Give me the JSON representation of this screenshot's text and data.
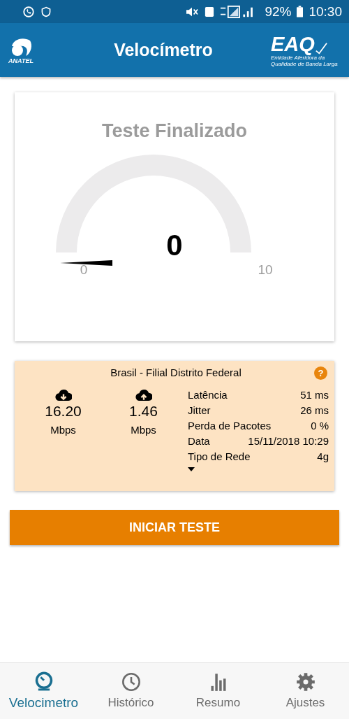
{
  "status_bar": {
    "battery": "92%",
    "time": "10:30"
  },
  "header": {
    "title": "Velocímetro",
    "left_logo": "ANATEL",
    "right_logo": "EAQ",
    "right_logo_caption": "Entidade Aferidora da Qualidade de Banda Larga"
  },
  "gauge": {
    "title": "Teste Finalizado",
    "value": "0",
    "min": "0",
    "max": "10"
  },
  "result": {
    "location": "Brasil - Filial Distrito Federal",
    "help": "?",
    "speeds": [
      {
        "kind": "download",
        "value": "16.20",
        "unit": "Mbps"
      },
      {
        "kind": "upload",
        "value": "1.46",
        "unit": "Mbps"
      }
    ],
    "details": [
      {
        "label": "Latência",
        "value": "51 ms"
      },
      {
        "label": "Jitter",
        "value": "26 ms"
      },
      {
        "label": "Perda de Pacotes",
        "value": "0 %"
      },
      {
        "label": "Data",
        "value": "15/11/2018 10:29"
      },
      {
        "label": "Tipo de Rede",
        "value": "4g"
      }
    ],
    "expanded": false
  },
  "start_button": "INICIAR TESTE",
  "nav": [
    {
      "kind": "speed",
      "label": "Velocimetro",
      "selected": true
    },
    {
      "kind": "history",
      "label": "Histórico",
      "selected": false
    },
    {
      "kind": "summary",
      "label": "Resumo",
      "selected": false
    },
    {
      "kind": "settings",
      "label": "Ajustes",
      "selected": false
    }
  ]
}
